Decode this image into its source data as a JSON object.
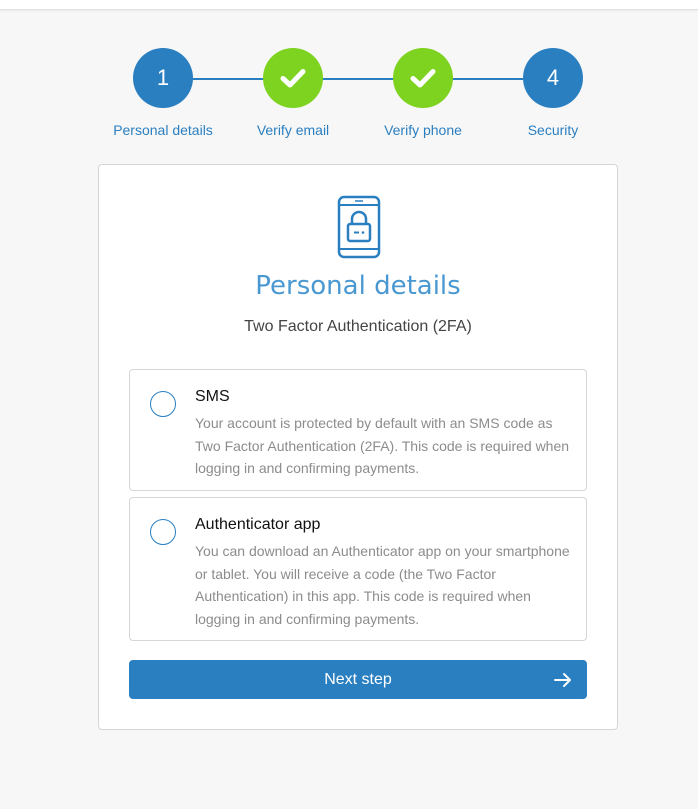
{
  "stepper": {
    "steps": [
      {
        "label": "Personal details",
        "number": "1",
        "state": "current"
      },
      {
        "label": "Verify email",
        "number": "",
        "state": "done"
      },
      {
        "label": "Verify phone",
        "number": "",
        "state": "done"
      },
      {
        "label": "Security",
        "number": "4",
        "state": "upcoming"
      }
    ]
  },
  "card": {
    "icon": "phone-lock-icon",
    "title": "Personal details",
    "subtitle": "Two Factor Authentication (2FA)",
    "options": [
      {
        "title": "SMS",
        "description": "Your account is protected by default with an SMS code as Two Factor Authentication (2FA). This code is required when logging in and confirming payments.",
        "selected": false
      },
      {
        "title": "Authenticator app",
        "description": "You can download an Authenticator app on your smartphone or tablet. You will receive a code (the Two Factor Authentication) in this app. This code is required when logging in and confirming payments.",
        "selected": false
      }
    ],
    "next_label": "Next step"
  },
  "colors": {
    "primary": "#2a7fc1",
    "success": "#7ed321",
    "title": "#4a98d2",
    "muted_text": "#8c8c8c"
  }
}
